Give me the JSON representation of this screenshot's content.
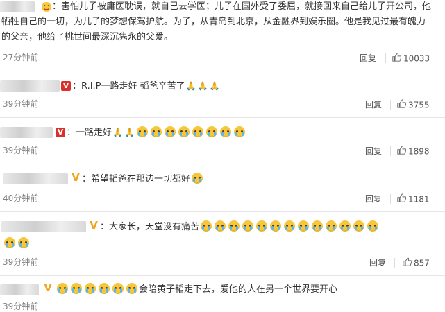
{
  "comments": [
    {
      "lines": [
        "：害怕儿子被庸医耽误，就自己去学医；儿子在国外受了委屈，就接回来自己给儿子开公司，他",
        "牺牲自己的一切，为儿子的梦想保驾护航。为子，从青岛到北京，从金融界到娱乐圈。他是我见过最有魄力",
        "的父亲，他给了桃世间最深沉隽永的父爱。"
      ],
      "time": "27分钟前",
      "reply": "回复",
      "likes": "10033"
    },
    {
      "lines": [
        "：R.I.P一路走好 韬爸辛苦了"
      ],
      "time": "39分钟前",
      "reply": "回复",
      "likes": "3755"
    },
    {
      "lines": [
        "：一路走好"
      ],
      "time": "39分钟前",
      "reply": "回复",
      "likes": "1898"
    },
    {
      "lines": [
        "：希望韬爸在那边一切都好"
      ],
      "time": "40分钟前",
      "reply": "回复",
      "likes": "1181"
    },
    {
      "lines": [
        "：大家长，天堂没有痛苦"
      ],
      "time": "39分钟前",
      "reply": "回复",
      "likes": "857"
    },
    {
      "lines": [
        "会陪黄子韬走下去，爱他的人在另一个世界要开心"
      ],
      "time": "39分钟前"
    }
  ],
  "icons": {
    "like": "thumbs-up-icon",
    "emoji_cry": "crying-face-icon",
    "emoji_pray": "praying-hands-icon"
  },
  "colors": {
    "badge_red": "#d9302c",
    "badge_gold": "#f0a41e",
    "emoji": "#f6c63d"
  }
}
